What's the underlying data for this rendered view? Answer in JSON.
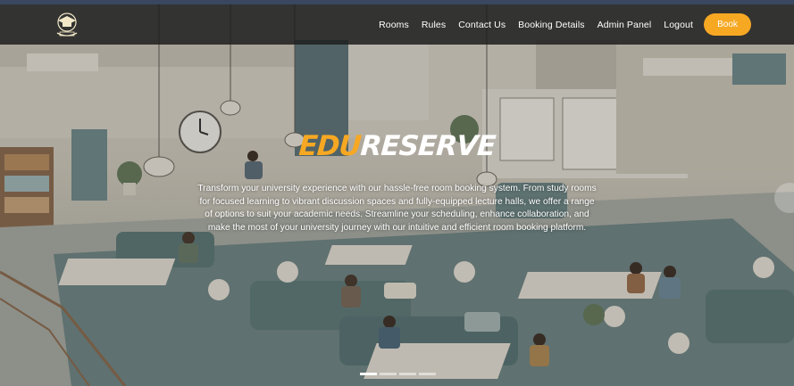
{
  "header": {
    "logo_icon": "graduation-cap-crest-icon",
    "nav": [
      {
        "label": "Rooms"
      },
      {
        "label": "Rules"
      },
      {
        "label": "Contact Us"
      },
      {
        "label": "Booking Details"
      },
      {
        "label": "Admin Panel"
      },
      {
        "label": "Logout"
      }
    ],
    "book_label": "Book"
  },
  "hero": {
    "brand_prefix": "EDU",
    "brand_suffix": "RESERVE",
    "description": "Transform your university experience with our hassle-free room booking system. From study rooms for focused learning to vibrant discussion spaces and fully-equipped lecture halls, we offer a range of options to suit your academic needs. Streamline your scheduling, enhance collaboration, and make the most of your university journey with our intuitive and efficient room booking platform.",
    "slides": 4,
    "active_slide": 1
  },
  "colors": {
    "accent": "#f7a823",
    "navbar": "#1e1e1e",
    "text": "#ffffff"
  }
}
